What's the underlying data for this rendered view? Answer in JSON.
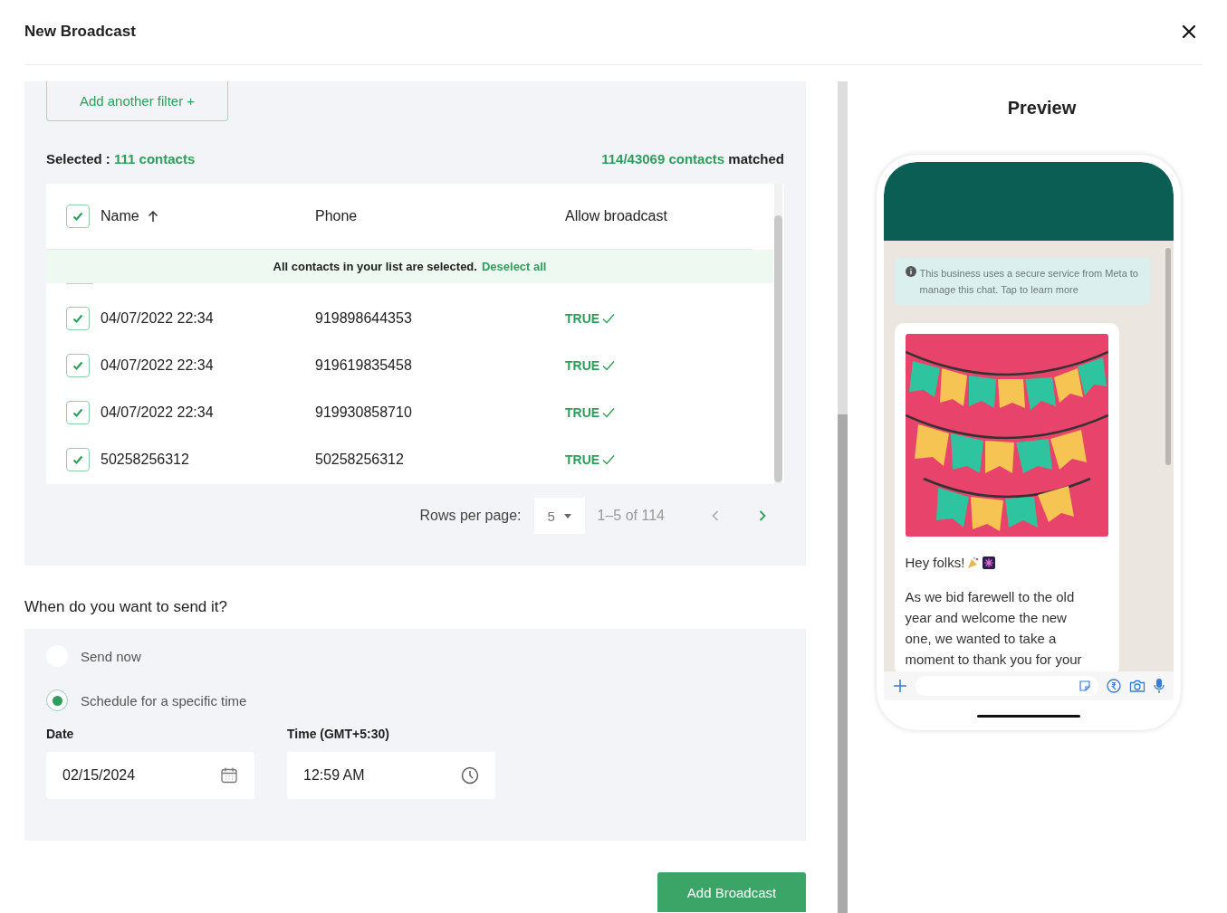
{
  "dialog": {
    "title": "New Broadcast"
  },
  "filter_button": "Add another filter +",
  "selection": {
    "label": "Selected :",
    "count": "111 contacts",
    "matched_count": "114/43069 contacts",
    "matched_suffix": "matched"
  },
  "table": {
    "all_checked": true,
    "columns": [
      {
        "label": "Name",
        "sorted": true
      },
      {
        "label": "Phone",
        "sorted": false
      },
      {
        "label": "Allow broadcast",
        "sorted": false
      }
    ],
    "banner": {
      "text": "All contacts in your list are selected.",
      "link": "Deselect all"
    },
    "rows": [
      {
        "checked": true,
        "name": "04/07/2022 22:34",
        "phone": "919898644353",
        "allow": "TRUE"
      },
      {
        "checked": true,
        "name": "04/07/2022 22:34",
        "phone": "919619835458",
        "allow": "TRUE"
      },
      {
        "checked": true,
        "name": "04/07/2022 22:34",
        "phone": "919930858710",
        "allow": "TRUE"
      },
      {
        "checked": true,
        "name": "50258256312",
        "phone": "50258256312",
        "allow": "TRUE"
      }
    ]
  },
  "pagination": {
    "label": "Rows per page:",
    "per_page": "5",
    "range": "1–5 of 114",
    "prev_disabled": true,
    "next_disabled": false
  },
  "schedule": {
    "question": "When do you want to send it?",
    "options": [
      {
        "label": "Send now",
        "selected": false
      },
      {
        "label": "Schedule for a specific time",
        "selected": true
      }
    ],
    "date": {
      "label": "Date",
      "value": "02/15/2024"
    },
    "time": {
      "label": "Time (GMT+5:30)",
      "value": "12:59 AM"
    }
  },
  "submit": "Add Broadcast",
  "preview": {
    "title": "Preview",
    "notice": "This business uses a secure service from Meta to manage this chat. Tap to learn more",
    "message": {
      "greeting": "Hey folks!",
      "body": "As we bid farewell to the old year and welcome the new one, we wanted to take a moment to thank you for your"
    }
  }
}
